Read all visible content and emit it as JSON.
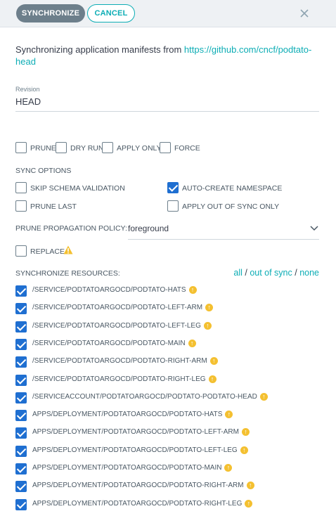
{
  "header": {
    "sync_label": "SYNCHRONIZE",
    "cancel_label": "CANCEL"
  },
  "intro": {
    "text": "Synchronizing application manifests from ",
    "repo_url": "https://github.com/cncf/podtato-head"
  },
  "revision": {
    "label": "Revision",
    "value": "HEAD"
  },
  "options_top": [
    {
      "label": "PRUNE",
      "checked": false
    },
    {
      "label": "DRY RUN",
      "checked": false
    },
    {
      "label": "APPLY ONLY",
      "checked": false
    },
    {
      "label": "FORCE",
      "checked": false
    }
  ],
  "sync_options": {
    "title": "SYNC OPTIONS",
    "items": [
      {
        "label": "SKIP SCHEMA VALIDATION",
        "checked": false
      },
      {
        "label": "AUTO-CREATE NAMESPACE",
        "checked": true
      },
      {
        "label": "PRUNE LAST",
        "checked": false
      },
      {
        "label": "APPLY OUT OF SYNC ONLY",
        "checked": false
      }
    ]
  },
  "prune_policy": {
    "label": "PRUNE PROPAGATION POLICY:",
    "value": "foreground"
  },
  "replace": {
    "label": "REPLACE",
    "checked": false
  },
  "resources": {
    "title": "SYNCHRONIZE RESOURCES:",
    "filter_all": "all",
    "filter_sep1": " / ",
    "filter_out_of_sync": "out of sync",
    "filter_sep2": " / ",
    "filter_none": "none",
    "items": [
      "/SERVICE/PODTATOARGOCD/PODTATO-HATS",
      "/SERVICE/PODTATOARGOCD/PODTATO-LEFT-ARM",
      "/SERVICE/PODTATOARGOCD/PODTATO-LEFT-LEG",
      "/SERVICE/PODTATOARGOCD/PODTATO-MAIN",
      "/SERVICE/PODTATOARGOCD/PODTATO-RIGHT-ARM",
      "/SERVICE/PODTATOARGOCD/PODTATO-RIGHT-LEG",
      "/SERVICEACCOUNT/PODTATOARGOCD/PODTATO-PODTATO-HEAD",
      "APPS/DEPLOYMENT/PODTATOARGOCD/PODTATO-HATS",
      "APPS/DEPLOYMENT/PODTATOARGOCD/PODTATO-LEFT-ARM",
      "APPS/DEPLOYMENT/PODTATOARGOCD/PODTATO-LEFT-LEG",
      "APPS/DEPLOYMENT/PODTATOARGOCD/PODTATO-MAIN",
      "APPS/DEPLOYMENT/PODTATOARGOCD/PODTATO-RIGHT-ARM",
      "APPS/DEPLOYMENT/PODTATOARGOCD/PODTATO-RIGHT-LEG"
    ]
  },
  "colors": {
    "accent": "#0dadb5",
    "checkbox": "#1f6fd1",
    "warning": "#f4c030"
  }
}
